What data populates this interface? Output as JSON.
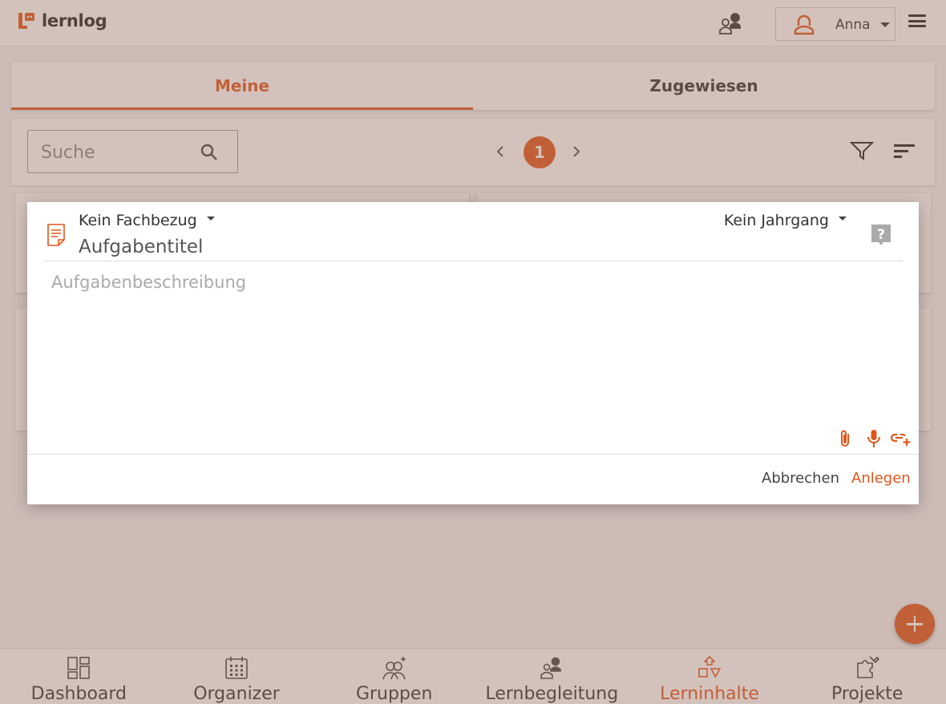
{
  "app": {
    "logo_text": "lernlog",
    "accent_color": "#e0561b",
    "user_name": "Anna"
  },
  "tabs": [
    {
      "label": "Meine",
      "active": true
    },
    {
      "label": "Zugewiesen",
      "active": false
    }
  ],
  "toolbar": {
    "search_placeholder": "Suche",
    "current_page": "1"
  },
  "dialog": {
    "subject_label": "Kein Fachbezug",
    "grade_label": "Kein Jahrgang",
    "title_placeholder": "Aufgabentitel",
    "description_placeholder": "Aufgabenbeschreibung",
    "cancel_label": "Abbrechen",
    "create_label": "Anlegen"
  },
  "bottom_nav": [
    {
      "label": "Dashboard",
      "icon": "dashboard-icon",
      "active": false
    },
    {
      "label": "Organizer",
      "icon": "calendar-icon",
      "active": false
    },
    {
      "label": "Gruppen",
      "icon": "groups-icon",
      "active": false
    },
    {
      "label": "Lernbegleitung",
      "icon": "mentoring-icon",
      "active": false
    },
    {
      "label": "Lerninhalte",
      "icon": "shapes-icon",
      "active": true
    },
    {
      "label": "Projekte",
      "icon": "puzzle-icon",
      "active": false
    }
  ]
}
